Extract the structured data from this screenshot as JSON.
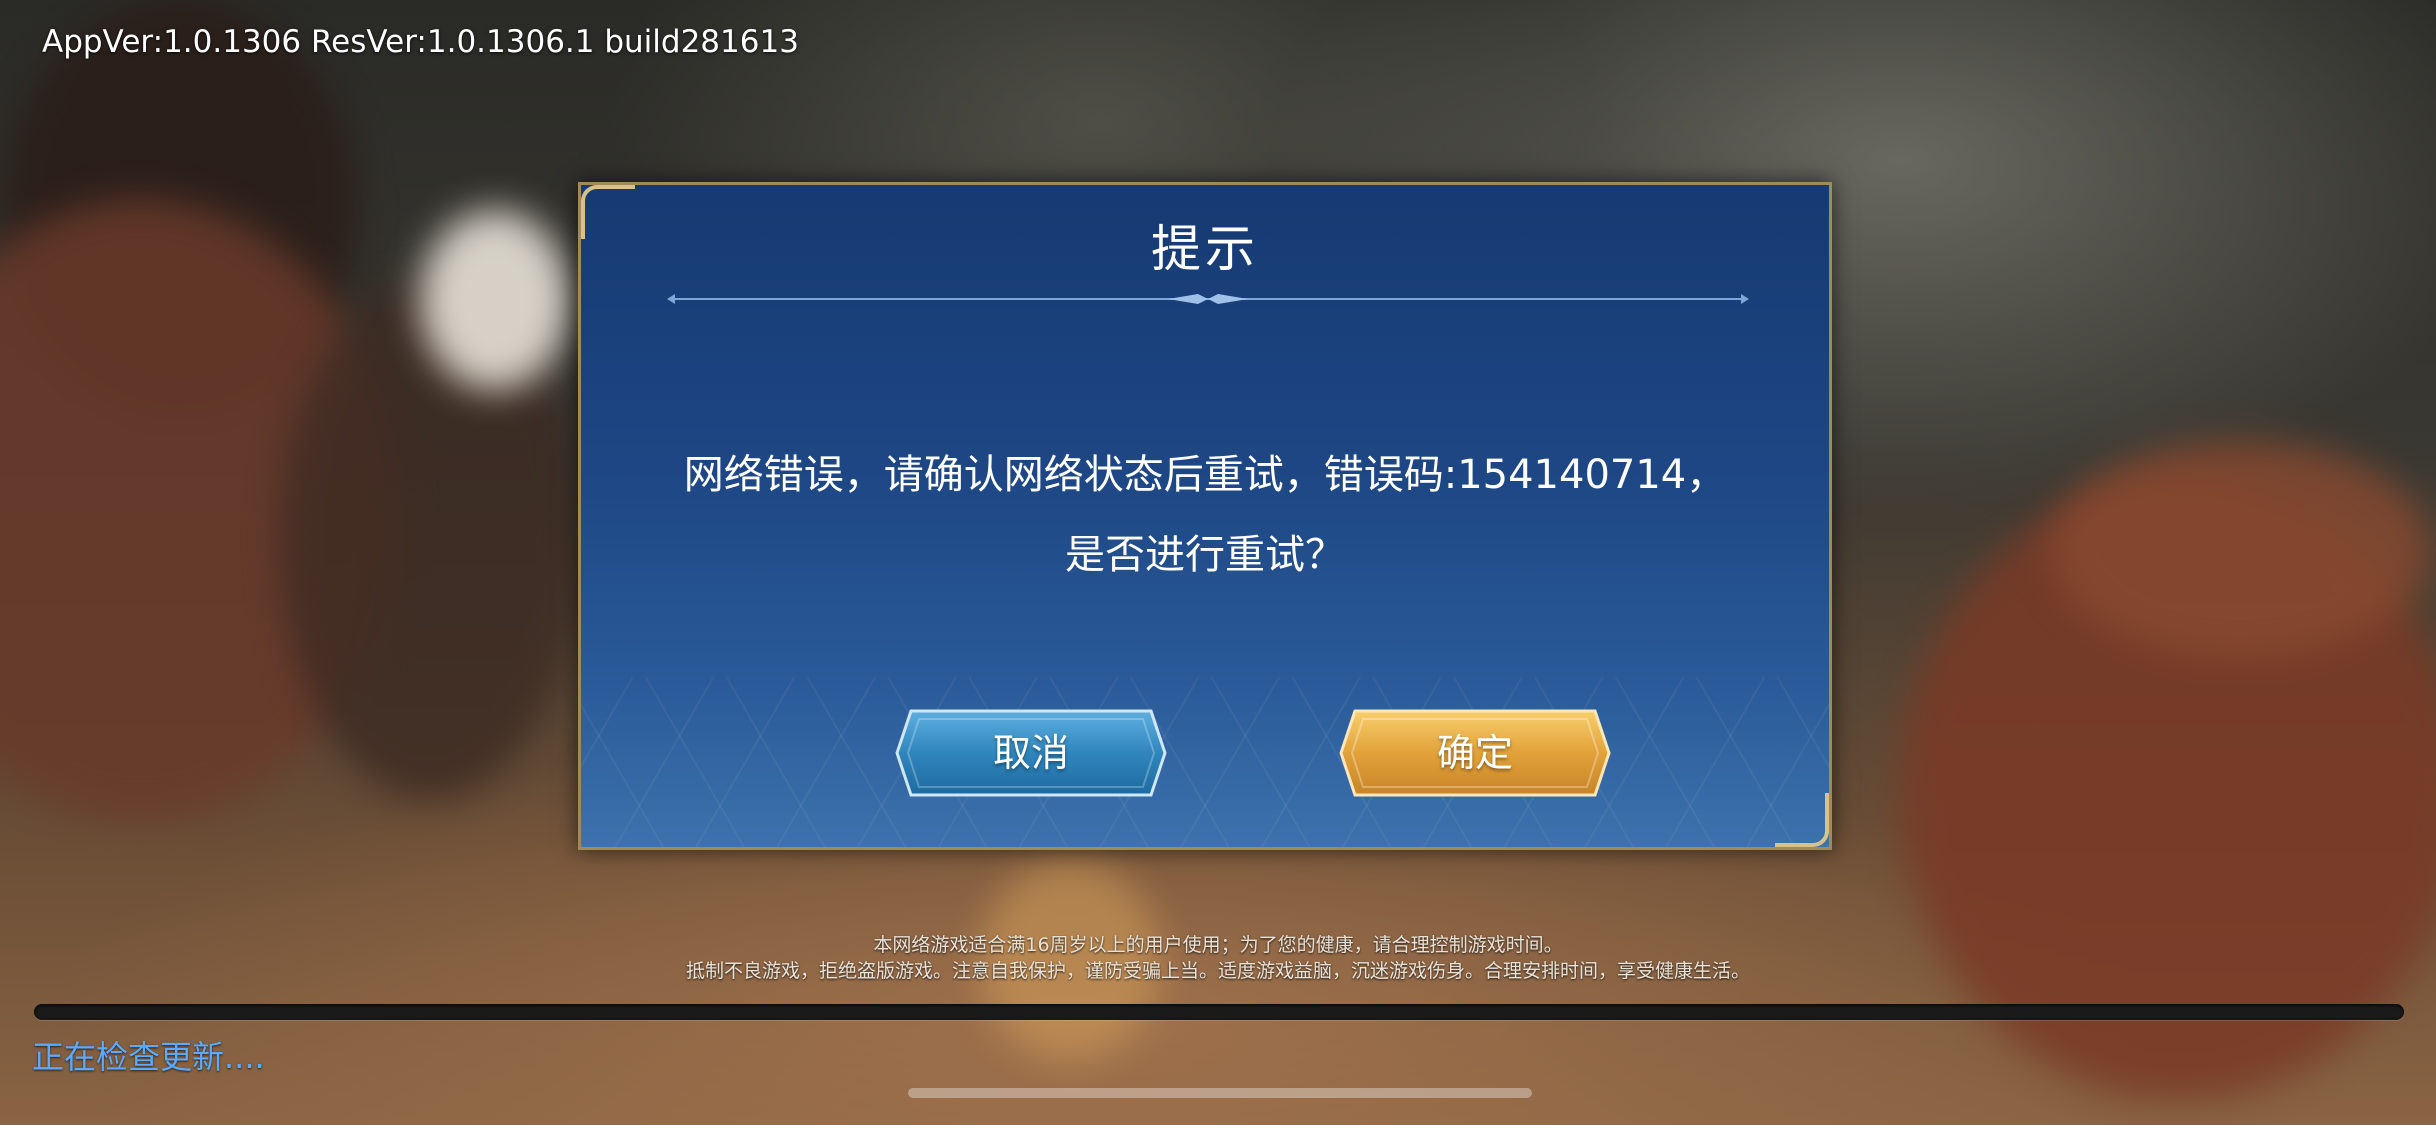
{
  "version": {
    "text": "AppVer:1.0.1306 ResVer:1.0.1306.1 build281613"
  },
  "dialog": {
    "title": "提示",
    "message_line1": "网络错误，请确认网络状态后重试，错误码:154140714，",
    "message_line2": "是否进行重试？",
    "cancel_label": "取消",
    "confirm_label": "确定"
  },
  "notice": {
    "line1": "本网络游戏适合满16周岁以上的用户使用；为了您的健康，请合理控制游戏时间。",
    "line2": "抵制不良游戏，拒绝盗版游戏。注意自我保护，谨防受骗上当。适度游戏益脑，沉迷游戏伤身。合理安排时间，享受健康生活。"
  },
  "loading": {
    "status_text": "正在检查更新....",
    "progress": 0
  },
  "colors": {
    "dialog_bg": "#1e4785",
    "dialog_border": "#a08a58",
    "cancel_button": "#2f7fb5",
    "confirm_button": "#e2a23a",
    "status_text": "#5aaaff"
  },
  "icons": {
    "divider": "ornament-divider-icon"
  }
}
